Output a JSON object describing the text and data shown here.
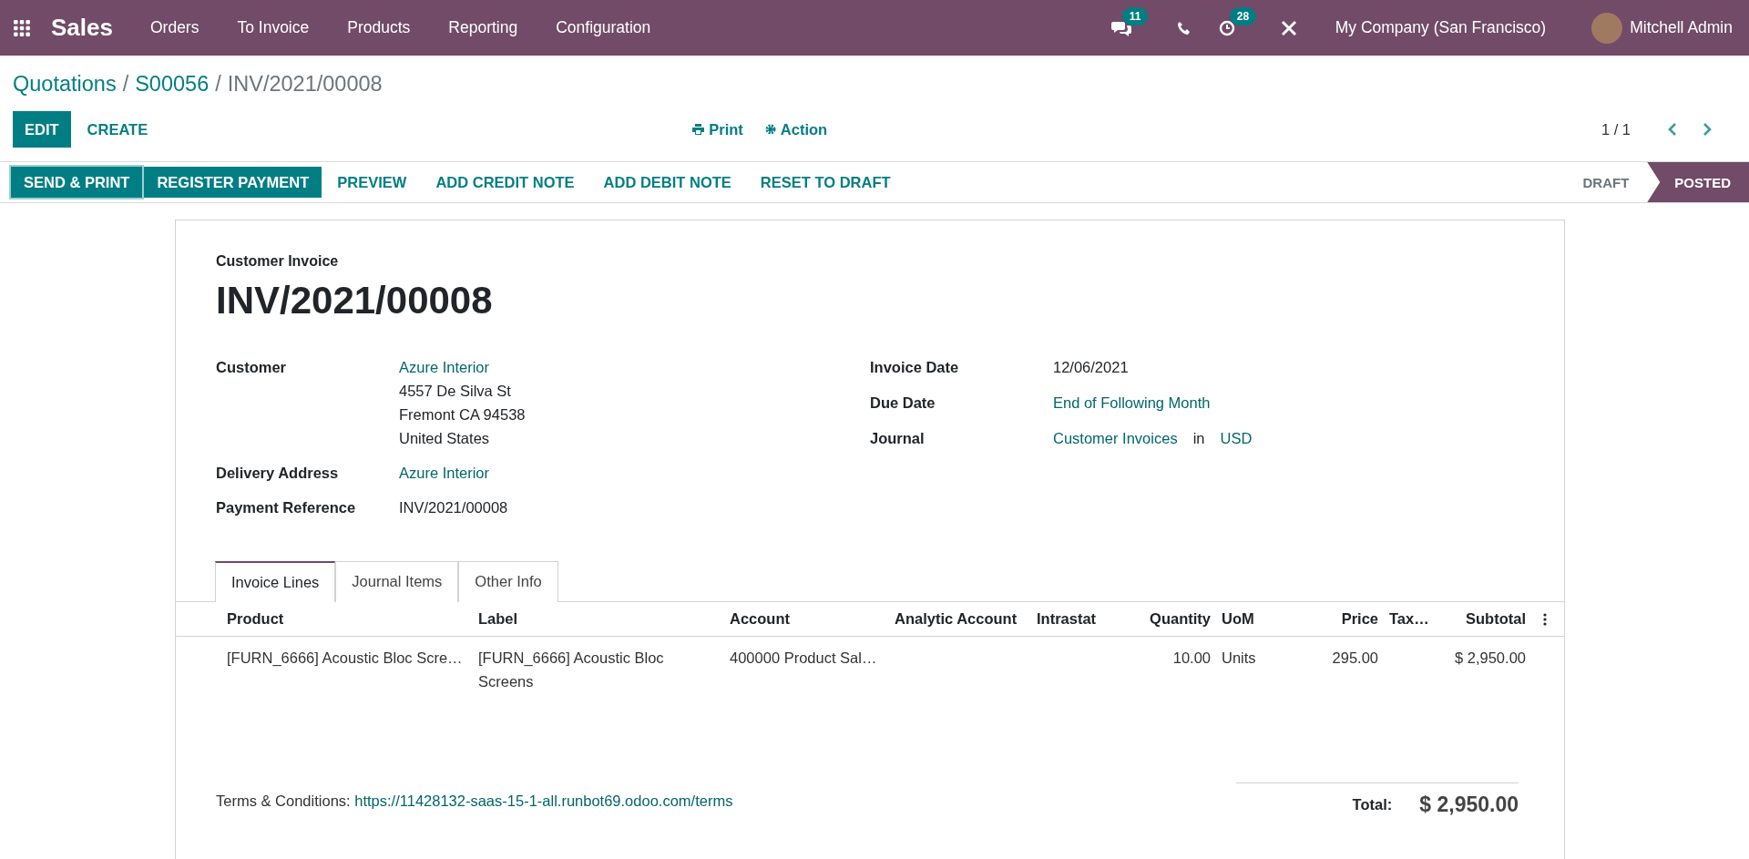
{
  "navbar": {
    "app": "Sales",
    "menu": [
      "Orders",
      "To Invoice",
      "Products",
      "Reporting",
      "Configuration"
    ],
    "messages_badge": "11",
    "activities_badge": "28",
    "company": "My Company (San Francisco)",
    "user": "Mitchell Admin"
  },
  "breadcrumb": [
    {
      "label": "Quotations",
      "link": true
    },
    {
      "separator": "/",
      "label": "S00056",
      "link": true
    },
    {
      "separator": "/",
      "label": "INV/2021/00008",
      "link": false
    }
  ],
  "control_panel": {
    "primary": "EDIT",
    "secondary": "CREATE",
    "print": "Print",
    "action": "Action",
    "pager": "1 / 1"
  },
  "action_buttons": [
    {
      "label": "SEND & PRINT",
      "kind": "primary-outlined"
    },
    {
      "label": "REGISTER PAYMENT",
      "kind": "primary"
    },
    {
      "label": "PREVIEW",
      "kind": "link"
    },
    {
      "label": "ADD CREDIT NOTE",
      "kind": "link"
    },
    {
      "label": "ADD DEBIT NOTE",
      "kind": "link"
    },
    {
      "label": "RESET TO DRAFT",
      "kind": "link"
    }
  ],
  "stages": [
    {
      "label": "DRAFT",
      "selected": false
    },
    {
      "label": "POSTED",
      "selected": true
    }
  ],
  "document": {
    "type": "Customer Invoice",
    "number": "INV/2021/00008",
    "left_fields": [
      {
        "label": "Customer",
        "lines": [
          {
            "text": "Azure Interior",
            "link": true
          },
          {
            "text": "4557 De Silva St",
            "link": false
          },
          {
            "text": "Fremont CA 94538",
            "link": false
          },
          {
            "text": "United States",
            "link": false
          }
        ]
      },
      {
        "label": "Delivery Address",
        "lines": [
          {
            "text": "Azure Interior",
            "link": true
          }
        ]
      },
      {
        "label": "Payment Reference",
        "lines": [
          {
            "text": "INV/2021/00008",
            "link": false
          }
        ]
      }
    ],
    "right_fields": [
      {
        "label": "Invoice Date",
        "parts": [
          {
            "text": "12/06/2021",
            "link": false
          }
        ]
      },
      {
        "label": "Due Date",
        "parts": [
          {
            "text": "End of Following Month",
            "link": true
          }
        ]
      },
      {
        "label": "Journal",
        "parts": [
          {
            "text": "Customer Invoices",
            "link": true
          },
          {
            "text": "in",
            "link": false
          },
          {
            "text": "USD",
            "link": true
          }
        ]
      }
    ]
  },
  "tabs": [
    {
      "label": "Invoice Lines",
      "selected": true
    },
    {
      "label": "Journal Items",
      "selected": false
    },
    {
      "label": "Other Info",
      "selected": false
    }
  ],
  "table": {
    "columns": [
      "Product",
      "Label",
      "Account",
      "Analytic Account",
      "Intrastat",
      "Quantity",
      "UoM",
      "Price",
      "Tax…",
      "Subtotal"
    ],
    "rows": [
      [
        "[FURN_6666] Acoustic Bloc Scre…",
        "[FURN_6666] Acoustic Bloc Screens",
        "400000 Product Sal…",
        "",
        "",
        "10.00",
        "Units",
        "295.00",
        "",
        "$ 2,950.00"
      ]
    ]
  },
  "terms": {
    "label": "Terms & Conditions:",
    "url": "https://11428132-saas-15-1-all.runbot69.odoo.com/terms"
  },
  "total": {
    "label": "Total:",
    "value": "$ 2,950.00"
  }
}
